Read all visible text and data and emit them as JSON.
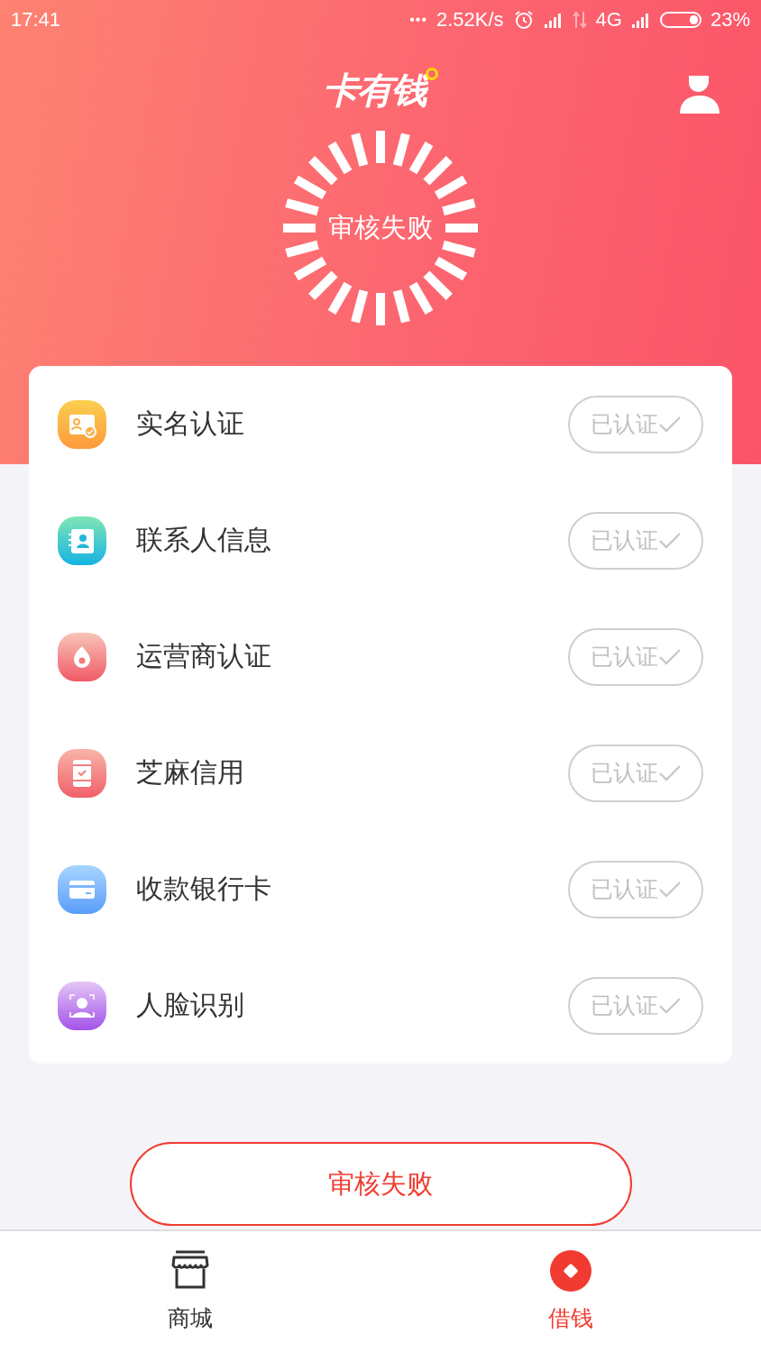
{
  "status_bar": {
    "time": "17:41",
    "dots": "•••",
    "speed": "2.52K/s",
    "network": "4G",
    "battery": "23%"
  },
  "header": {
    "logo": "卡有钱",
    "status": "审核失败"
  },
  "verifications": [
    {
      "label": "实名认证",
      "verified": true,
      "badge": "已认证"
    },
    {
      "label": "联系人信息",
      "verified": true,
      "badge": "已认证"
    },
    {
      "label": "运营商认证",
      "verified": true,
      "badge": "已认证"
    },
    {
      "label": "芝麻信用",
      "verified": true,
      "badge": "已认证"
    },
    {
      "label": "收款银行卡",
      "verified": true,
      "badge": "已认证"
    },
    {
      "label": "人脸识别",
      "verified": true,
      "badge": "已认证"
    }
  ],
  "action_button": {
    "label": "审核失败"
  },
  "bottom_nav": [
    {
      "label": "商城",
      "selected": false
    },
    {
      "label": "借钱",
      "selected": true
    }
  ]
}
